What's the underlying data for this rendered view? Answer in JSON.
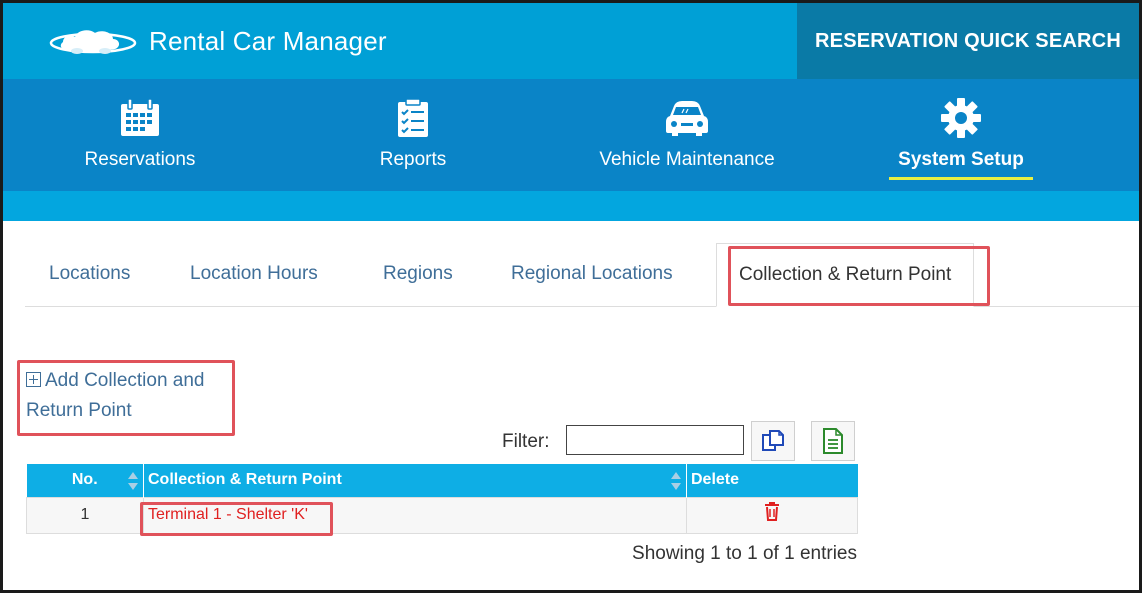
{
  "app": {
    "title": "Rental Car Manager",
    "quick_search": "RESERVATION QUICK SEARCH"
  },
  "nav": {
    "items": [
      {
        "label": "Reservations",
        "icon": "calendar-icon"
      },
      {
        "label": "Reports",
        "icon": "checklist-icon"
      },
      {
        "label": "Vehicle Maintenance",
        "icon": "car-icon"
      },
      {
        "label": "System Setup",
        "icon": "gear-icon",
        "active": true
      }
    ]
  },
  "tabs": [
    {
      "label": "Locations"
    },
    {
      "label": "Location Hours"
    },
    {
      "label": "Regions"
    },
    {
      "label": "Regional Locations"
    },
    {
      "label": "Collection & Return Point",
      "active": true
    }
  ],
  "add_link": {
    "line1": "Add Collection and",
    "line2": "Return Point"
  },
  "filter": {
    "label": "Filter:",
    "value": ""
  },
  "table": {
    "columns": [
      "No.",
      "Collection & Return Point",
      "Delete"
    ],
    "rows": [
      {
        "no": "1",
        "point": "Terminal 1 - Shelter 'K'"
      }
    ],
    "summary": "Showing 1 to 1 of 1 entries"
  },
  "colors": {
    "topbar": "#00a0d6",
    "quick_search_bg": "#0a7aa6",
    "mainnav": "#0a84c7",
    "subbar": "#03a6df",
    "table_header": "#0eaee5",
    "highlight": "#e0525a",
    "link": "#3f6e98",
    "delete": "#e02020",
    "active_underline": "#e8ef43"
  }
}
